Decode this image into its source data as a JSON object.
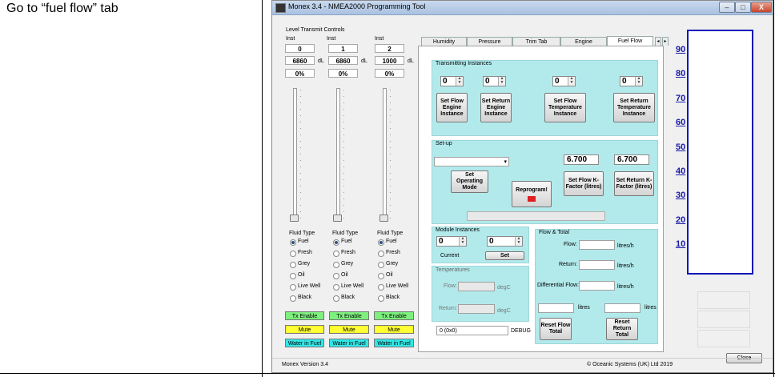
{
  "doc": {
    "instruction": "Go to “fuel flow” tab"
  },
  "window": {
    "title": "Monex 3.4 - NMEA2000 Programming Tool",
    "version": "Monex Version 3.4",
    "copyright": "© Oceanic Systems (UK) Ltd 2019",
    "close_label": "Close",
    "min_label": "–",
    "max_label": "□",
    "x_label": "X"
  },
  "level_controls": {
    "title": "Level Transmit Controls",
    "columns": [
      {
        "inst_label": "Inst",
        "inst": "0",
        "volume": "6860",
        "unit": "dL",
        "percent": "0%",
        "fluid_label": "Fluid Type",
        "level": 0
      },
      {
        "inst_label": "Inst",
        "inst": "1",
        "volume": "6860",
        "unit": "dL",
        "percent": "0%",
        "fluid_label": "Fluid Type",
        "level": 0
      },
      {
        "inst_label": "Inst",
        "inst": "2",
        "volume": "1000",
        "unit": "dL",
        "percent": "0%",
        "fluid_label": "Fluid Type",
        "level": 0
      }
    ],
    "fluid_types": [
      "Fuel",
      "Fresh",
      "Grey",
      "Oil",
      "Live Well",
      "Black"
    ],
    "selected_fluid": "Fuel",
    "tx_enable": "Tx Enable",
    "mute": "Mute",
    "water_in_fuel": "Water in Fuel",
    "colors": {
      "tx": "#7ef07e",
      "mute": "#ffff33",
      "water": "#33e6e6"
    }
  },
  "tabs": [
    "Humidity",
    "Pressure",
    "Trim Tab",
    "Engine",
    "Fuel Flow"
  ],
  "active_tab": "Fuel Flow",
  "tab_scroll": {
    "left": "◂",
    "right": "▸"
  },
  "transmitting": {
    "title": "Transmitting Instances",
    "spinners": [
      "0",
      "0",
      "0",
      "0"
    ],
    "buttons": [
      "Set Flow Engine Instance",
      "Set Return Engine Instance",
      "Set Flow Temperature Instance",
      "Set Return Temperature Instance"
    ]
  },
  "setup": {
    "title": "Set-up",
    "dropdown_value": "",
    "k_flow": "6.700",
    "k_return": "6.700",
    "set_operating_mode": "Set Operating Mode",
    "reprogram": "Reprogram!",
    "set_flow_k": "Set Flow K-Factor (litres)",
    "set_return_k": "Set Return K-Factor (litres)"
  },
  "module": {
    "title": "Module Instances",
    "current_value": "0",
    "new_value": "0",
    "current_label": "Current",
    "set_label": "Set"
  },
  "temperatures": {
    "title": "Temperatures",
    "flow_label": "Flow:",
    "return_label": "Return:",
    "unit": "degC"
  },
  "flow_total": {
    "title": "Flow & Total",
    "flow_label": "Flow:",
    "return_label": "Return:",
    "diff_label": "Differential Flow:",
    "unit": "litres/h",
    "litres": "litres",
    "reset_flow": "Reset Flow Total",
    "reset_return": "Reset Return Total"
  },
  "debug": {
    "value": "0 (0x0)",
    "label": "DEBUG"
  },
  "gauge": {
    "labels": [
      "90",
      "80",
      "70",
      "60",
      "50",
      "40",
      "30",
      "20",
      "10"
    ],
    "color": "#1016b8"
  }
}
